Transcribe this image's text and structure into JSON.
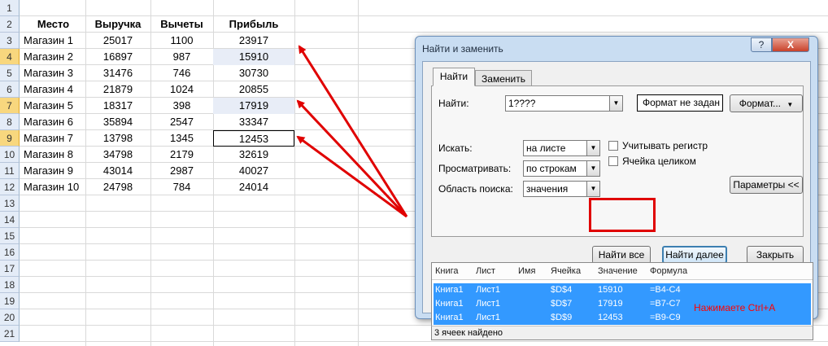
{
  "sheet": {
    "row_numbers": [
      "1",
      "2",
      "3",
      "4",
      "5",
      "6",
      "7",
      "8",
      "9",
      "10",
      "11",
      "12",
      "13",
      "14",
      "15",
      "16",
      "17",
      "18",
      "19",
      "20",
      "21"
    ],
    "headers": [
      "Место",
      "Выручка",
      "Вычеты",
      "Прибыль"
    ],
    "rows": [
      [
        "Магазин 1",
        "25017",
        "1100",
        "23917"
      ],
      [
        "Магазин 2",
        "16897",
        "987",
        "15910"
      ],
      [
        "Магазин 3",
        "31476",
        "746",
        "30730"
      ],
      [
        "Магазин 4",
        "21879",
        "1024",
        "20855"
      ],
      [
        "Магазин 5",
        "18317",
        "398",
        "17919"
      ],
      [
        "Магазин 6",
        "35894",
        "2547",
        "33347"
      ],
      [
        "Магазин 7",
        "13798",
        "1345",
        "12453"
      ],
      [
        "Магазин 8",
        "34798",
        "2179",
        "32619"
      ],
      [
        "Магазин 9",
        "43014",
        "2987",
        "40027"
      ],
      [
        "Магазин 10",
        "24798",
        "784",
        "24014"
      ]
    ]
  },
  "dialog": {
    "title": "Найти и заменить",
    "help_label": "?",
    "close_label": "X",
    "tabs": [
      "Найти",
      "Заменить"
    ],
    "find_label": "Найти:",
    "find_value": "1????",
    "format_status": "Формат не задан",
    "format_button": "Формат...",
    "within_label": "Искать:",
    "within_value": "на листе",
    "search_label": "Просматривать:",
    "search_value": "по строкам",
    "lookin_label": "Область поиска:",
    "lookin_value": "значения",
    "match_case_label": "Учитывать регистр",
    "match_entire_label": "Ячейка целиком",
    "options_button": "Параметры <<",
    "find_all_button": "Найти все",
    "find_next_button": "Найти далее",
    "close_button": "Закрыть",
    "results_columns": [
      "Книга",
      "Лист",
      "Имя",
      "Ячейка",
      "Значение",
      "Формула"
    ],
    "results": [
      [
        "Книга1",
        "Лист1",
        "",
        "$D$4",
        "15910",
        "=B4-C4"
      ],
      [
        "Книга1",
        "Лист1",
        "",
        "$D$7",
        "17919",
        "=B7-C7"
      ],
      [
        "Книга1",
        "Лист1",
        "",
        "$D$9",
        "12453",
        "=B9-C9"
      ]
    ],
    "status": "3 ячеек найдено",
    "note": "Нажимаете Ctrl+A"
  },
  "colors": {
    "arrow": "#e00000",
    "selection": "#3399ff",
    "row_highlight": "#f8d77e"
  }
}
